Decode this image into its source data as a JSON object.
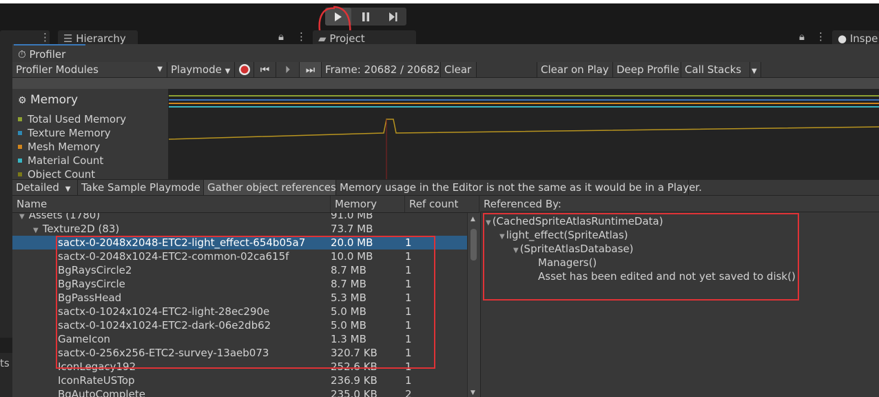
{
  "top": {
    "play_icon": "play-icon",
    "pause_icon": "pause-icon",
    "step_icon": "step-icon"
  },
  "tabs": {
    "hierarchy": "Hierarchy",
    "project": "Project",
    "inspector": "Inspe"
  },
  "left_panel_fragment": "ts",
  "profiler": {
    "title": "Profiler",
    "toolbar": {
      "modules": "Profiler Modules",
      "playmode": "Playmode",
      "frame": "Frame: 20682 / 20682",
      "clear": "Clear",
      "clear_on_play": "Clear on Play",
      "deep_profile": "Deep Profile",
      "call_stacks": "Call Stacks"
    },
    "module_title": "Memory",
    "legend": [
      {
        "label": "Total Used Memory",
        "color": "#8fa232"
      },
      {
        "label": "Texture Memory",
        "color": "#2f8ab5"
      },
      {
        "label": "Mesh Memory",
        "color": "#d1851c"
      },
      {
        "label": "Material Count",
        "color": "#38b6c4"
      },
      {
        "label": "Object Count",
        "color": "#7c7a18"
      }
    ],
    "bar2": {
      "view": "Detailed",
      "take_sample": "Take Sample Playmode",
      "gather": "Gather object references",
      "notice": "Memory usage in the Editor is not the same as it would be in a Player."
    },
    "columns": {
      "name": "Name",
      "memory": "Memory",
      "ref_count": "Ref count"
    },
    "rows": [
      {
        "name": "Assets (1780)",
        "memory": "91.0 MB",
        "ref": ""
      },
      {
        "name": "Texture2D (83)",
        "memory": "73.7 MB",
        "ref": ""
      },
      {
        "name": "sactx-0-2048x2048-ETC2-light_effect-654b05a7",
        "memory": "20.0 MB",
        "ref": "1"
      },
      {
        "name": "sactx-0-2048x1024-ETC2-common-02ca615f",
        "memory": "10.0 MB",
        "ref": "1"
      },
      {
        "name": "BgRaysCircle2",
        "memory": "8.7 MB",
        "ref": "1"
      },
      {
        "name": "BgRaysCircle",
        "memory": "8.7 MB",
        "ref": "1"
      },
      {
        "name": "BgPassHead",
        "memory": "5.3 MB",
        "ref": "1"
      },
      {
        "name": "sactx-0-1024x1024-ETC2-light-28ec290e",
        "memory": "5.0 MB",
        "ref": "1"
      },
      {
        "name": "sactx-0-1024x1024-ETC2-dark-06e2db62",
        "memory": "5.0 MB",
        "ref": "1"
      },
      {
        "name": "GameIcon",
        "memory": "1.3 MB",
        "ref": "1"
      },
      {
        "name": "sactx-0-256x256-ETC2-survey-13aeb073",
        "memory": "320.7 KB",
        "ref": "1"
      },
      {
        "name": "IconLegacy192",
        "memory": "252.6 KB",
        "ref": "1"
      },
      {
        "name": "IconRateUSTop",
        "memory": "236.9 KB",
        "ref": "1"
      },
      {
        "name": "BgAutoComplete",
        "memory": "235.0 KB",
        "ref": "2"
      }
    ],
    "referenced_by": {
      "header": "Referenced By:",
      "items": [
        "(CachedSpriteAtlasRuntimeData)",
        "light_effect(SpriteAtlas)",
        "(SpriteAtlasDatabase)",
        "Managers()",
        "Asset has been edited and not yet saved to disk()"
      ]
    }
  }
}
